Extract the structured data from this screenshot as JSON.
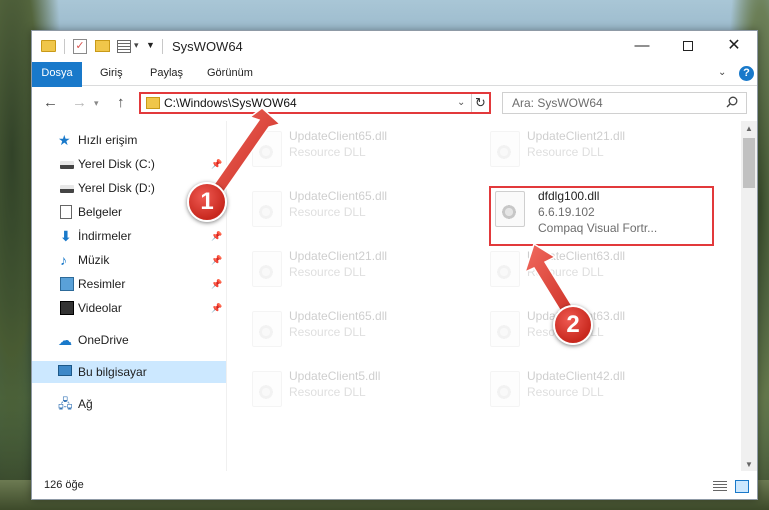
{
  "window": {
    "title": "SysWOW64",
    "minimize_glyph": "—",
    "close_glyph": "✕"
  },
  "ribbon": {
    "tabs": [
      "Dosya",
      "Giriş",
      "Paylaş",
      "Görünüm"
    ],
    "help_glyph": "?"
  },
  "navbar": {
    "back_glyph": "←",
    "forward_glyph": "→",
    "up_glyph": "↑",
    "address": "C:\\Windows\\SysWOW64",
    "search_placeholder": "Ara: SysWOW64"
  },
  "sidebar": {
    "items": [
      {
        "label": "Hızlı erişim",
        "icon": "star-icon"
      },
      {
        "label": "Yerel Disk (C:)",
        "icon": "drive-icon",
        "pinned": true
      },
      {
        "label": "Yerel Disk (D:)",
        "icon": "drive-icon",
        "pinned": true
      },
      {
        "label": "Belgeler",
        "icon": "documents-icon",
        "pinned": true
      },
      {
        "label": "İndirmeler",
        "icon": "download-icon",
        "pinned": true
      },
      {
        "label": "Müzik",
        "icon": "music-icon",
        "pinned": true
      },
      {
        "label": "Resimler",
        "icon": "pictures-icon",
        "pinned": true
      },
      {
        "label": "Videolar",
        "icon": "videos-icon",
        "pinned": true
      },
      {
        "label": "OneDrive",
        "icon": "cloud-icon"
      },
      {
        "label": "Bu bilgisayar",
        "icon": "computer-icon",
        "selected": true
      },
      {
        "label": "Ağ",
        "icon": "network-icon"
      }
    ]
  },
  "files": [
    {
      "name": "UpdateClient65.dll",
      "desc": "Resource DLL"
    },
    {
      "name": "UpdateClient21.dll",
      "desc": "Resource DLL"
    },
    {
      "name": "UpdateClient65.dll",
      "desc": "Resource DLL"
    },
    {
      "name": "dfdlg100.dll",
      "desc": "6.6.19.102",
      "desc2": "Compaq Visual Fortr..."
    },
    {
      "name": "UpdateClient21.dll",
      "desc": "Resource DLL"
    },
    {
      "name": "UpdateClient63.dll",
      "desc": "Resource DLL"
    },
    {
      "name": "UpdateClient65.dll",
      "desc": "Resource DLL"
    },
    {
      "name": "UpdateClient63.dll",
      "desc": "Resource DLL"
    },
    {
      "name": "UpdateClient5.dll",
      "desc": "Resource DLL"
    },
    {
      "name": "UpdateClient42.dll",
      "desc": "Resource DLL"
    }
  ],
  "status": {
    "item_count": "126 öğe"
  },
  "annotations": {
    "badge1": "1",
    "badge2": "2",
    "highlight_color": "#e2393b"
  }
}
